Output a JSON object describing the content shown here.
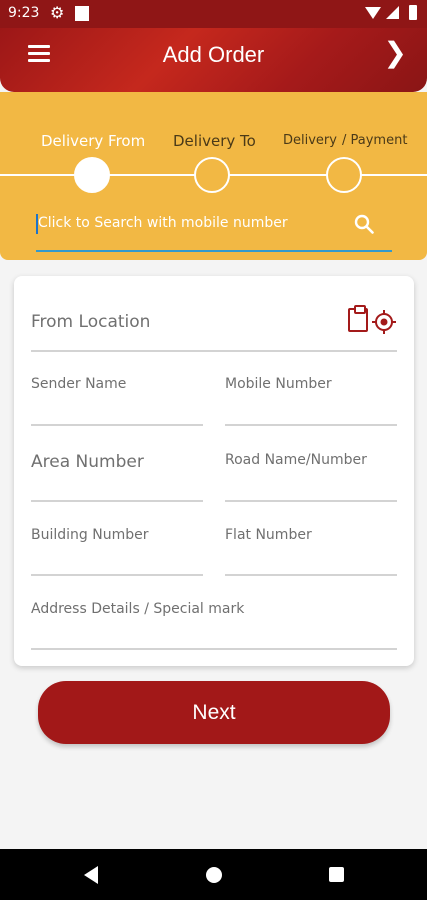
{
  "status_bar": {
    "time": "9:23",
    "icons": [
      "gear-icon",
      "square-notification-icon",
      "wifi-icon",
      "signal-icon",
      "battery-icon"
    ]
  },
  "header": {
    "title": "Add Order",
    "left_icon": "menu-icon",
    "right_icon": "chevron-right-icon",
    "color": "#a21818"
  },
  "stepper": {
    "steps": [
      {
        "label": "Delivery From",
        "active": true
      },
      {
        "label": "Delivery To",
        "active": false
      },
      {
        "label": "Delivery",
        "active": false
      },
      {
        "label": "/ Payment",
        "active": false
      }
    ],
    "background": "#f2b844"
  },
  "search": {
    "placeholder": "Click to Search with mobile number",
    "icon": "search-icon"
  },
  "form": {
    "from_location": "From Location",
    "sender_name": "Sender Name",
    "mobile_number": "Mobile Number",
    "area_number": "Area Number",
    "road_name": "Road Name/Number",
    "building_number": "Building Number",
    "flat_number": "Flat Number",
    "address_details": "Address Details / Special mark",
    "icons": [
      "clipboard-icon",
      "my-location-icon"
    ]
  },
  "next_button": {
    "label": "Next"
  },
  "nav_bar": {
    "icons": [
      "back-icon",
      "home-icon",
      "recents-icon"
    ]
  }
}
